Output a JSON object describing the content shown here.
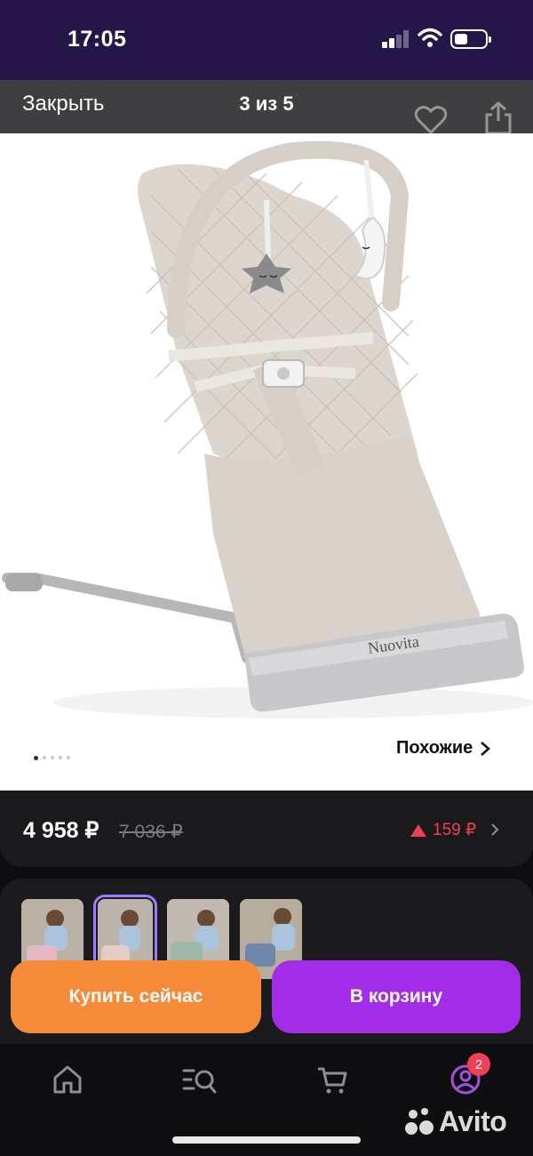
{
  "status_bar": {
    "time": "17:05"
  },
  "header": {
    "close_label": "Закрыть",
    "page_counter": "3 из 5"
  },
  "photo": {
    "brand_text": "Nuovita",
    "carousel": {
      "total": 5,
      "active_index": 0
    },
    "similar_label": "Похожие"
  },
  "price": {
    "current": "4 958 ₽",
    "old": "7 036 ₽",
    "delta": "159 ₽"
  },
  "actions": {
    "buy_now_label": "Купить сейчас",
    "cart_label": "В корзину"
  },
  "nav": {
    "icons": [
      "home-icon",
      "catalog-search-icon",
      "cart-icon",
      "profile-icon"
    ],
    "badge_count": "2"
  },
  "watermark": "Avito",
  "colors": {
    "status_bar_bg": "#251649",
    "buy_now": "#f58a38",
    "cart": "#a32de6",
    "price_delta": "#ef3f55",
    "badge": "#ef3f55",
    "selected_thumb_outline": "#9a7dff"
  }
}
